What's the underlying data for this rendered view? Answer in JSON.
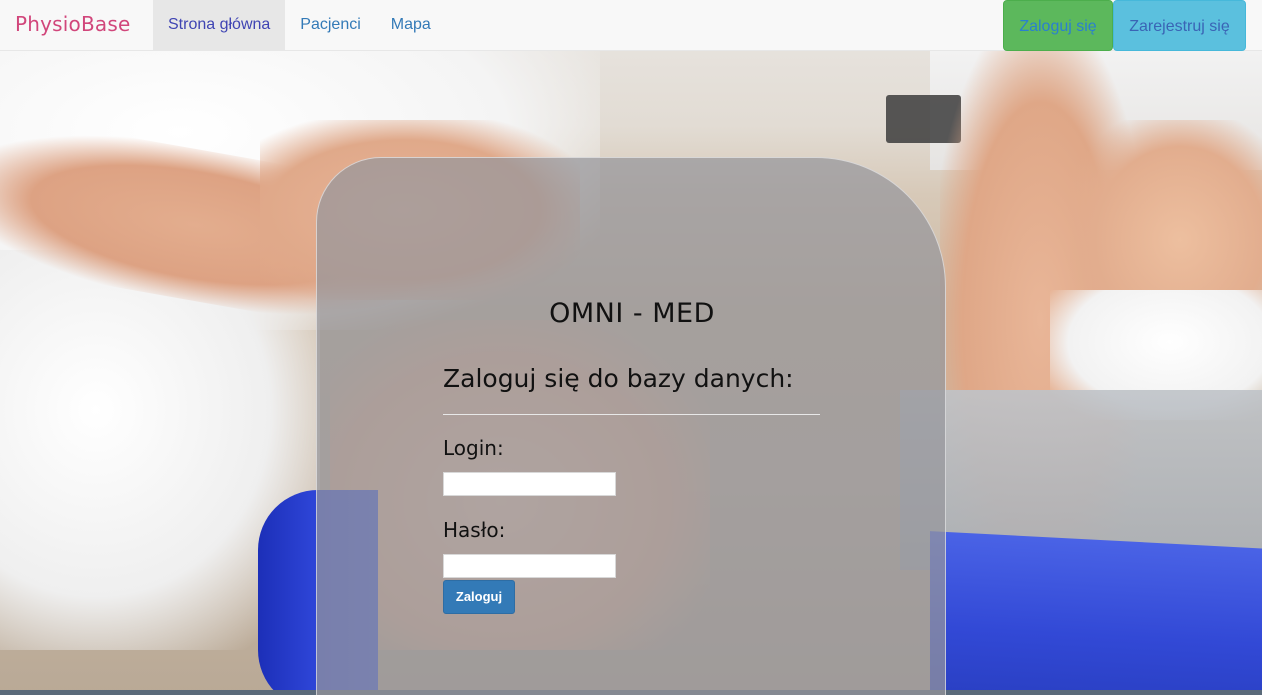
{
  "navbar": {
    "brand": "PhysioBase",
    "links": [
      {
        "label": "Strona główna",
        "active": true
      },
      {
        "label": "Pacjenci",
        "active": false
      },
      {
        "label": "Mapa",
        "active": false
      }
    ],
    "login_label": "Zaloguj się",
    "register_label": "Zarejestruj się"
  },
  "login_panel": {
    "title": "OMNI - MED",
    "heading": "Zaloguj się do bazy danych:",
    "login_label": "Login:",
    "login_value": "",
    "password_label": "Hasło:",
    "password_value": "",
    "submit_label": "Zaloguj"
  },
  "colors": {
    "brand": "#d1467b",
    "link": "#337ab7",
    "login_button": "#5cb85c",
    "register_button": "#5bc0de",
    "submit_button": "#337ab7"
  }
}
